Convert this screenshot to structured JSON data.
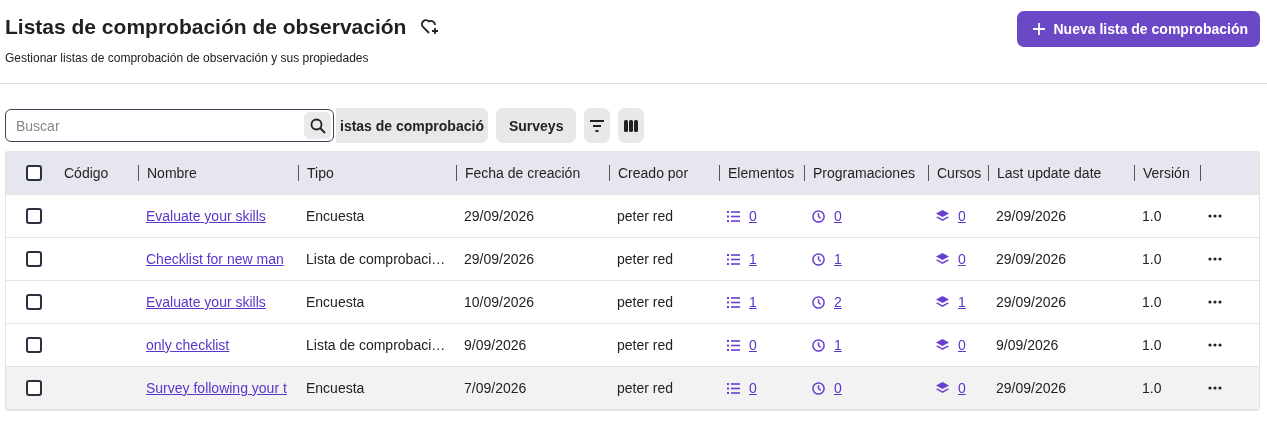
{
  "header": {
    "title": "Listas de comprobación de observación",
    "subtitle": "Gestionar listas de comprobación de observación y sus propiedades",
    "new_button": "Nueva lista de comprobación"
  },
  "toolbar": {
    "search": {
      "placeholder": "Buscar"
    },
    "chips": [
      "istas de comprobació",
      "Surveys"
    ]
  },
  "table": {
    "select_all": {
      "checked": false
    },
    "columns": [
      "Código",
      "Nombre",
      "Tipo",
      "Fecha de creación",
      "Creado por",
      "Elementos",
      "Programaciones",
      "Cursos",
      "Last update date",
      "Versión"
    ],
    "rows": [
      {
        "checked": false,
        "highlighted": false,
        "code": "",
        "name": "Evaluate your skills",
        "type": "Encuesta",
        "created": "29/09/2026",
        "author": "peter red",
        "items": "0",
        "schedules": "0",
        "courses": "0",
        "updated": "29/09/2026",
        "version": "1.0"
      },
      {
        "checked": false,
        "highlighted": false,
        "code": "",
        "name": "Checklist for new man",
        "type": "Lista de comprobaci…",
        "created": "29/09/2026",
        "author": "peter red",
        "items": "1",
        "schedules": "1",
        "courses": "0",
        "updated": "29/09/2026",
        "version": "1.0"
      },
      {
        "checked": false,
        "highlighted": false,
        "code": "",
        "name": "Evaluate your skills",
        "type": "Encuesta",
        "created": "10/09/2026",
        "author": "peter red",
        "items": "1",
        "schedules": "2",
        "courses": "1",
        "updated": "29/09/2026",
        "version": "1.0"
      },
      {
        "checked": false,
        "highlighted": false,
        "code": "",
        "name": "only checklist",
        "type": "Lista de comprobaci…",
        "created": "9/09/2026",
        "author": "peter red",
        "items": "0",
        "schedules": "1",
        "courses": "0",
        "updated": "9/09/2026",
        "version": "1.0"
      },
      {
        "checked": false,
        "highlighted": true,
        "code": "",
        "name": "Survey following your t",
        "type": "Encuesta",
        "created": "7/09/2026",
        "author": "peter red",
        "items": "0",
        "schedules": "0",
        "courses": "0",
        "updated": "29/09/2026",
        "version": "1.0"
      }
    ]
  }
}
